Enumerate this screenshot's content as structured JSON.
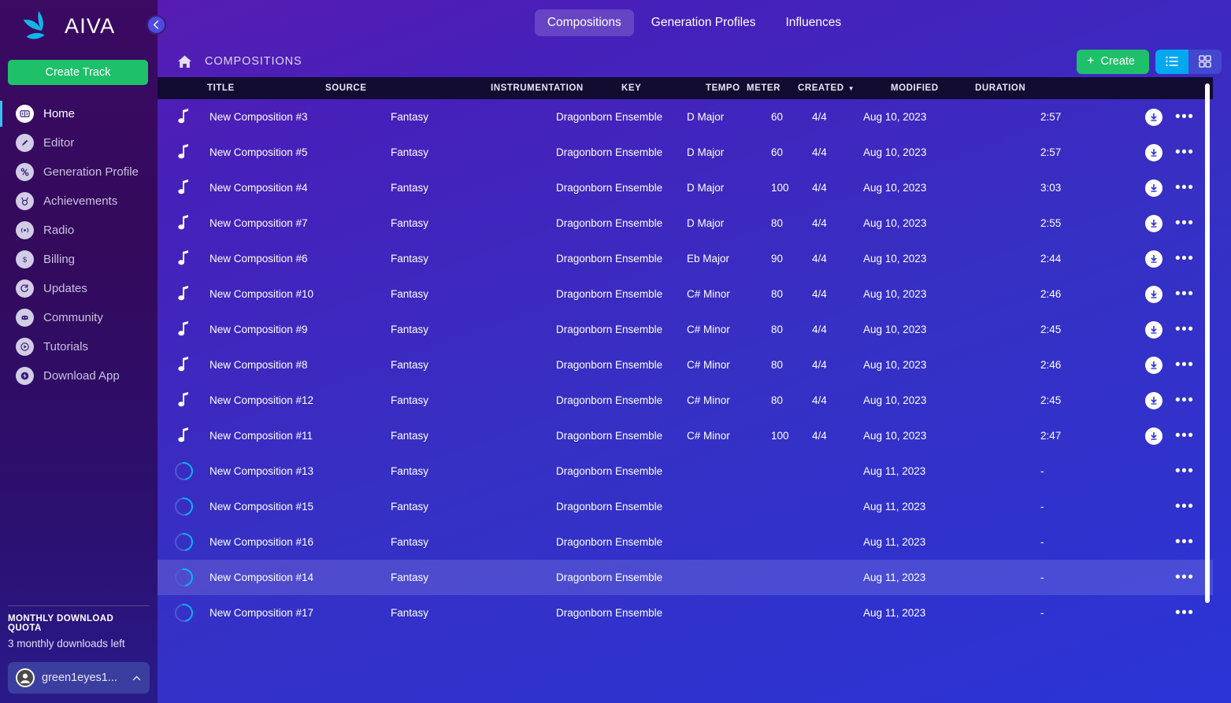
{
  "brand": {
    "name": "AIVA",
    "logo_icon": "aiva-logo-icon",
    "collapse_icon": "chevron-left-icon"
  },
  "sidebar": {
    "create_track_label": "Create Track",
    "items": [
      {
        "label": "Home",
        "icon": "home-waveform-icon",
        "active": true
      },
      {
        "label": "Editor",
        "icon": "pencil-icon",
        "active": false
      },
      {
        "label": "Generation Profile",
        "icon": "sliders-icon",
        "active": false
      },
      {
        "label": "Achievements",
        "icon": "medal-icon",
        "active": false
      },
      {
        "label": "Radio",
        "icon": "radio-waves-icon",
        "active": false
      },
      {
        "label": "Billing",
        "icon": "dollar-icon",
        "active": false
      },
      {
        "label": "Updates",
        "icon": "refresh-icon",
        "active": false
      },
      {
        "label": "Community",
        "icon": "discord-icon",
        "active": false
      },
      {
        "label": "Tutorials",
        "icon": "play-icon",
        "active": false
      },
      {
        "label": "Download App",
        "icon": "download-bolt-icon",
        "active": false
      }
    ],
    "quota_title": "MONTHLY DOWNLOAD QUOTA",
    "quota_text": "3 monthly downloads left",
    "account_name": "green1eyes1...",
    "account_avatar_icon": "user-avatar-icon",
    "account_chevron_icon": "chevron-up-icon"
  },
  "topnav": {
    "tabs": [
      {
        "label": "Compositions",
        "active": true
      },
      {
        "label": "Generation Profiles",
        "active": false
      },
      {
        "label": "Influences",
        "active": false
      }
    ]
  },
  "subbar": {
    "home_icon": "home-icon",
    "breadcrumb": "COMPOSITIONS",
    "create_label": "Create",
    "create_plus": "+",
    "view_list_icon": "list-view-icon",
    "view_grid_icon": "grid-view-icon",
    "view_active": "list"
  },
  "colors": {
    "accent_green": "#1fc06a",
    "accent_cyan": "#00a8f0",
    "header_bar": "#120c30",
    "sidebar_top": "#3b0a63"
  },
  "table": {
    "columns": [
      "TITLE",
      "SOURCE",
      "INSTRUMENTATION",
      "KEY",
      "TEMPO",
      "METER",
      "CREATED",
      "MODIFIED",
      "DURATION"
    ],
    "sorted_column": "CREATED",
    "sort_caret": "▼",
    "rows": [
      {
        "status": "note",
        "title": "New Composition #3",
        "source": "Fantasy",
        "instrumentation": "Dragonborn Ensemble",
        "key": "D Major",
        "tempo": "60",
        "meter": "4/4",
        "created": "Aug 10, 2023",
        "modified": "",
        "duration": "2:57",
        "download": true,
        "selected": false
      },
      {
        "status": "note",
        "title": "New Composition #5",
        "source": "Fantasy",
        "instrumentation": "Dragonborn Ensemble",
        "key": "D Major",
        "tempo": "60",
        "meter": "4/4",
        "created": "Aug 10, 2023",
        "modified": "",
        "duration": "2:57",
        "download": true,
        "selected": false
      },
      {
        "status": "note",
        "title": "New Composition #4",
        "source": "Fantasy",
        "instrumentation": "Dragonborn Ensemble",
        "key": "D Major",
        "tempo": "100",
        "meter": "4/4",
        "created": "Aug 10, 2023",
        "modified": "",
        "duration": "3:03",
        "download": true,
        "selected": false
      },
      {
        "status": "note",
        "title": "New Composition #7",
        "source": "Fantasy",
        "instrumentation": "Dragonborn Ensemble",
        "key": "D Major",
        "tempo": "80",
        "meter": "4/4",
        "created": "Aug 10, 2023",
        "modified": "",
        "duration": "2:55",
        "download": true,
        "selected": false
      },
      {
        "status": "note",
        "title": "New Composition #6",
        "source": "Fantasy",
        "instrumentation": "Dragonborn Ensemble",
        "key": "Eb Major",
        "tempo": "90",
        "meter": "4/4",
        "created": "Aug 10, 2023",
        "modified": "",
        "duration": "2:44",
        "download": true,
        "selected": false
      },
      {
        "status": "note",
        "title": "New Composition #10",
        "source": "Fantasy",
        "instrumentation": "Dragonborn Ensemble",
        "key": "C# Minor",
        "tempo": "80",
        "meter": "4/4",
        "created": "Aug 10, 2023",
        "modified": "",
        "duration": "2:46",
        "download": true,
        "selected": false
      },
      {
        "status": "note",
        "title": "New Composition #9",
        "source": "Fantasy",
        "instrumentation": "Dragonborn Ensemble",
        "key": "C# Minor",
        "tempo": "80",
        "meter": "4/4",
        "created": "Aug 10, 2023",
        "modified": "",
        "duration": "2:45",
        "download": true,
        "selected": false
      },
      {
        "status": "note",
        "title": "New Composition #8",
        "source": "Fantasy",
        "instrumentation": "Dragonborn Ensemble",
        "key": "C# Minor",
        "tempo": "80",
        "meter": "4/4",
        "created": "Aug 10, 2023",
        "modified": "",
        "duration": "2:46",
        "download": true,
        "selected": false
      },
      {
        "status": "note",
        "title": "New Composition #12",
        "source": "Fantasy",
        "instrumentation": "Dragonborn Ensemble",
        "key": "C# Minor",
        "tempo": "80",
        "meter": "4/4",
        "created": "Aug 10, 2023",
        "modified": "",
        "duration": "2:45",
        "download": true,
        "selected": false
      },
      {
        "status": "note",
        "title": "New Composition #11",
        "source": "Fantasy",
        "instrumentation": "Dragonborn Ensemble",
        "key": "C# Minor",
        "tempo": "100",
        "meter": "4/4",
        "created": "Aug 10, 2023",
        "modified": "",
        "duration": "2:47",
        "download": true,
        "selected": false
      },
      {
        "status": "loading",
        "title": "New Composition #13",
        "source": "Fantasy",
        "instrumentation": "Dragonborn Ensemble",
        "key": "",
        "tempo": "",
        "meter": "",
        "created": "Aug 11, 2023",
        "modified": "",
        "duration": "-",
        "download": false,
        "selected": false
      },
      {
        "status": "loading",
        "title": "New Composition #15",
        "source": "Fantasy",
        "instrumentation": "Dragonborn Ensemble",
        "key": "",
        "tempo": "",
        "meter": "",
        "created": "Aug 11, 2023",
        "modified": "",
        "duration": "-",
        "download": false,
        "selected": false
      },
      {
        "status": "loading",
        "title": "New Composition #16",
        "source": "Fantasy",
        "instrumentation": "Dragonborn Ensemble",
        "key": "",
        "tempo": "",
        "meter": "",
        "created": "Aug 11, 2023",
        "modified": "",
        "duration": "-",
        "download": false,
        "selected": false
      },
      {
        "status": "loading",
        "title": "New Composition #14",
        "source": "Fantasy",
        "instrumentation": "Dragonborn Ensemble",
        "key": "",
        "tempo": "",
        "meter": "",
        "created": "Aug 11, 2023",
        "modified": "",
        "duration": "-",
        "download": false,
        "selected": true
      },
      {
        "status": "loading",
        "title": "New Composition #17",
        "source": "Fantasy",
        "instrumentation": "Dragonborn Ensemble",
        "key": "",
        "tempo": "",
        "meter": "",
        "created": "Aug 11, 2023",
        "modified": "",
        "duration": "-",
        "download": false,
        "selected": false
      }
    ],
    "row_menu_glyph": "•••"
  }
}
